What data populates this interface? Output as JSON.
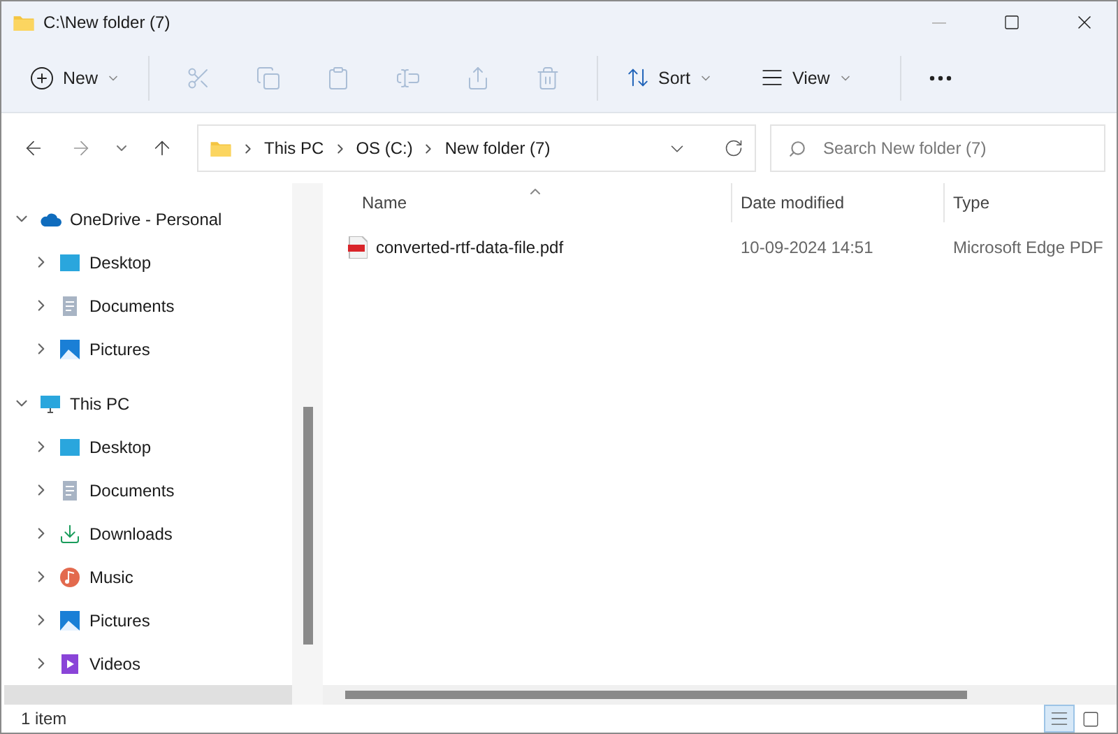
{
  "window": {
    "title": "C:\\New folder (7)"
  },
  "toolbar": {
    "new_button": {
      "label": "New"
    },
    "actions": [
      {
        "kind": "cut",
        "disabled": true
      },
      {
        "kind": "copy",
        "disabled": true
      },
      {
        "kind": "paste",
        "disabled": true
      },
      {
        "kind": "rename",
        "disabled": true
      },
      {
        "kind": "share",
        "disabled": true
      },
      {
        "kind": "delete",
        "disabled": true
      }
    ],
    "menus": [
      {
        "kind": "sort",
        "label": "Sort"
      },
      {
        "kind": "view",
        "label": "View"
      }
    ]
  },
  "navigation": {
    "back_disabled": false,
    "forward_disabled": true
  },
  "address_bar": {
    "crumbs": [
      "This PC",
      "OS (C:)",
      "New folder (7)"
    ]
  },
  "search": {
    "placeholder": "Search New folder (7)"
  },
  "sidebar": {
    "items": [
      {
        "label": "OneDrive - Personal",
        "kind": "cloud",
        "expanded": true,
        "children": [
          {
            "label": "Desktop",
            "kind": "desktop",
            "expanded": false
          },
          {
            "label": "Documents",
            "kind": "documents",
            "expanded": false
          },
          {
            "label": "Pictures",
            "kind": "pictures",
            "expanded": false
          }
        ]
      },
      {
        "label": "This PC",
        "kind": "pc",
        "expanded": true,
        "children": [
          {
            "label": "Desktop",
            "kind": "desktop",
            "expanded": false
          },
          {
            "label": "Documents",
            "kind": "documents",
            "expanded": false
          },
          {
            "label": "Downloads",
            "kind": "downloads",
            "expanded": false
          },
          {
            "label": "Music",
            "kind": "music",
            "expanded": false
          },
          {
            "label": "Pictures",
            "kind": "pictures",
            "expanded": false
          },
          {
            "label": "Videos",
            "kind": "videos",
            "expanded": false
          }
        ]
      }
    ],
    "cut_off_item": {
      "selected": true
    }
  },
  "table": {
    "columns": [
      {
        "label": "Name",
        "sorted": true
      },
      {
        "label": "Date modified",
        "sorted": false
      },
      {
        "label": "Type",
        "sorted": false
      }
    ],
    "rows": [
      {
        "name": "converted-rtf-data-file.pdf",
        "date": "10-09-2024 14:51",
        "type": "Microsoft Edge PDF"
      }
    ]
  },
  "status_bar": {
    "count": "1 item",
    "views": [
      {
        "kind": "details",
        "selected": true
      },
      {
        "kind": "tiles",
        "selected": false
      }
    ]
  }
}
